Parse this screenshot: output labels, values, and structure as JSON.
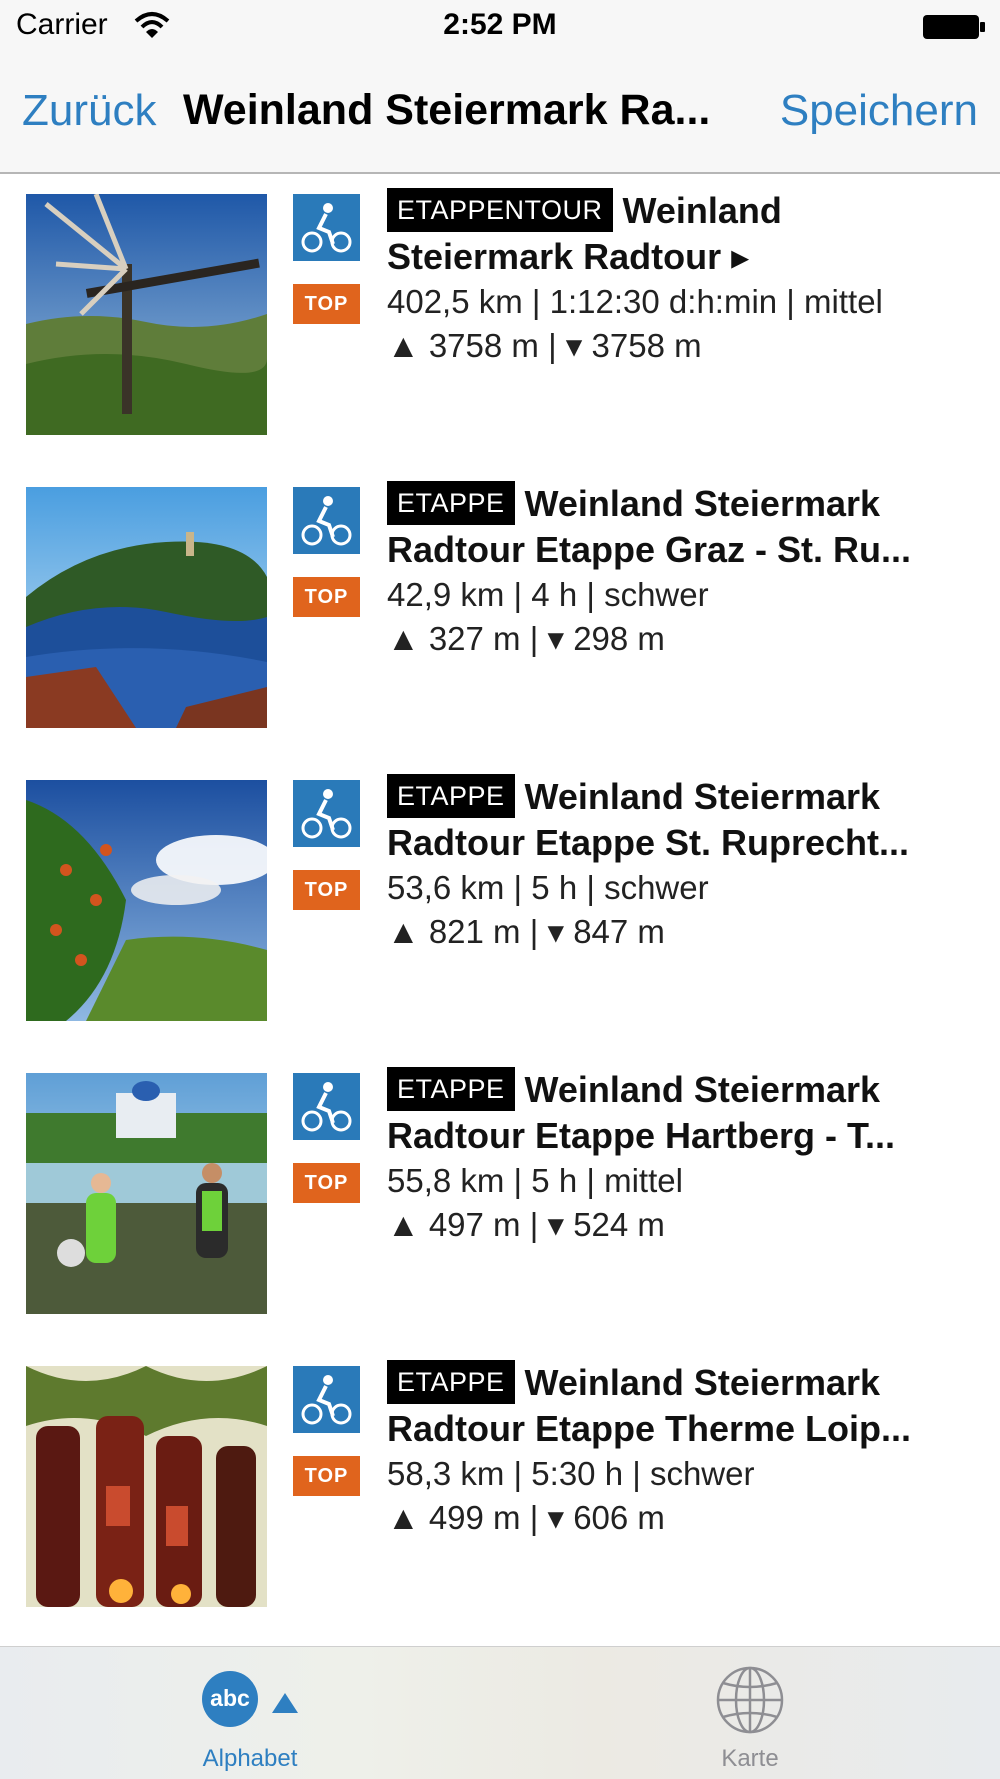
{
  "status_bar": {
    "carrier": "Carrier",
    "time": "2:52 PM"
  },
  "nav": {
    "back_label": "Zurück",
    "title": "Weinland Steiermark Ra...",
    "save_label": "Speichern"
  },
  "tours": [
    {
      "tag": "ETAPPENTOUR",
      "title_line1": "Weinland",
      "title_line2": "Steiermark Radtour ▸",
      "stats": "402,5 km | 1:12:30 d:h:min | mittel",
      "elevation": "▲ 3758 m | ▾ 3758 m",
      "badge": "TOP",
      "type_icon": "bicycle-icon"
    },
    {
      "tag": "ETAPPE",
      "title_line1": "Weinland Steiermark",
      "title_line2": "Radtour Etappe Graz - St. Ru...",
      "stats": "42,9 km | 4 h | schwer",
      "elevation": "▲ 327 m | ▾ 298 m",
      "badge": "TOP",
      "type_icon": "bicycle-icon"
    },
    {
      "tag": "ETAPPE",
      "title_line1": "Weinland Steiermark",
      "title_line2": "Radtour Etappe St. Ruprecht...",
      "stats": "53,6 km | 5 h | schwer",
      "elevation": "▲ 821 m | ▾ 847 m",
      "badge": "TOP",
      "type_icon": "bicycle-icon"
    },
    {
      "tag": "ETAPPE",
      "title_line1": "Weinland Steiermark",
      "title_line2": "Radtour Etappe Hartberg - T...",
      "stats": "55,8 km | 5 h | mittel",
      "elevation": "▲ 497 m | ▾ 524 m",
      "badge": "TOP",
      "type_icon": "bicycle-icon"
    },
    {
      "tag": "ETAPPE",
      "title_line1": "Weinland Steiermark",
      "title_line2": "Radtour Etappe Therme Loip...",
      "stats": "58,3 km | 5:30 h | schwer",
      "elevation": "▲ 499 m | ▾ 606 m",
      "badge": "TOP",
      "type_icon": "bicycle-icon"
    }
  ],
  "tab_bar": {
    "tabs": [
      {
        "label": "Alphabet",
        "icon_text": "abc",
        "active": true
      },
      {
        "label": "Karte",
        "active": false
      }
    ]
  },
  "colors": {
    "accent": "#2e7fc1",
    "top_badge": "#e0641d",
    "type_badge": "#2a7ab9",
    "tag_bg": "#000000",
    "inactive_tab": "#8e8e93"
  }
}
